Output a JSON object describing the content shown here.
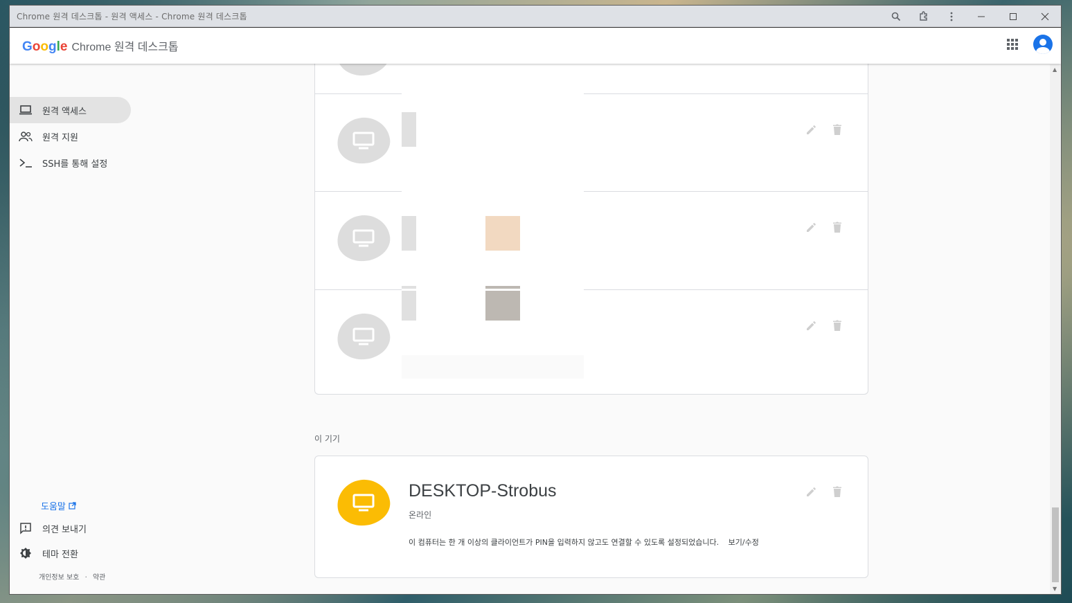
{
  "window": {
    "title": "Chrome 원격 데스크톱 - 원격 액세스 - Chrome 원격 데스크톱"
  },
  "appbar": {
    "logo_letters": [
      "G",
      "o",
      "o",
      "g",
      "l",
      "e"
    ],
    "logo_colors": [
      "#4285f4",
      "#ea4335",
      "#fbbc04",
      "#4285f4",
      "#34a853",
      "#ea4335"
    ],
    "product": "Chrome 원격 데스크톱"
  },
  "sidebar": {
    "items": [
      {
        "label": "원격 액세스",
        "icon": "laptop-icon",
        "active": true
      },
      {
        "label": "원격 지원",
        "icon": "people-icon",
        "active": false
      },
      {
        "label": "SSH를 통해 설정",
        "icon": "terminal-icon",
        "active": false
      }
    ],
    "help": "도움말",
    "feedback": "의견 보내기",
    "theme": "테마 전환",
    "privacy": "개인정보 보호",
    "separator": "·",
    "terms": "약관"
  },
  "local_section": {
    "label": "이 기기",
    "host_name": "DESKTOP-Strobus",
    "status": "온라인",
    "description": "이 컴퓨터는 한 개 이상의 클라이언트가 PIN을 입력하지 않고도 연결할 수 있도록 설정되었습니다.",
    "view_edit": "보기/수정"
  },
  "colors": {
    "accent": "#1a73e8",
    "online_icon": "#fbbc04",
    "offline_icon": "#dddddd"
  }
}
